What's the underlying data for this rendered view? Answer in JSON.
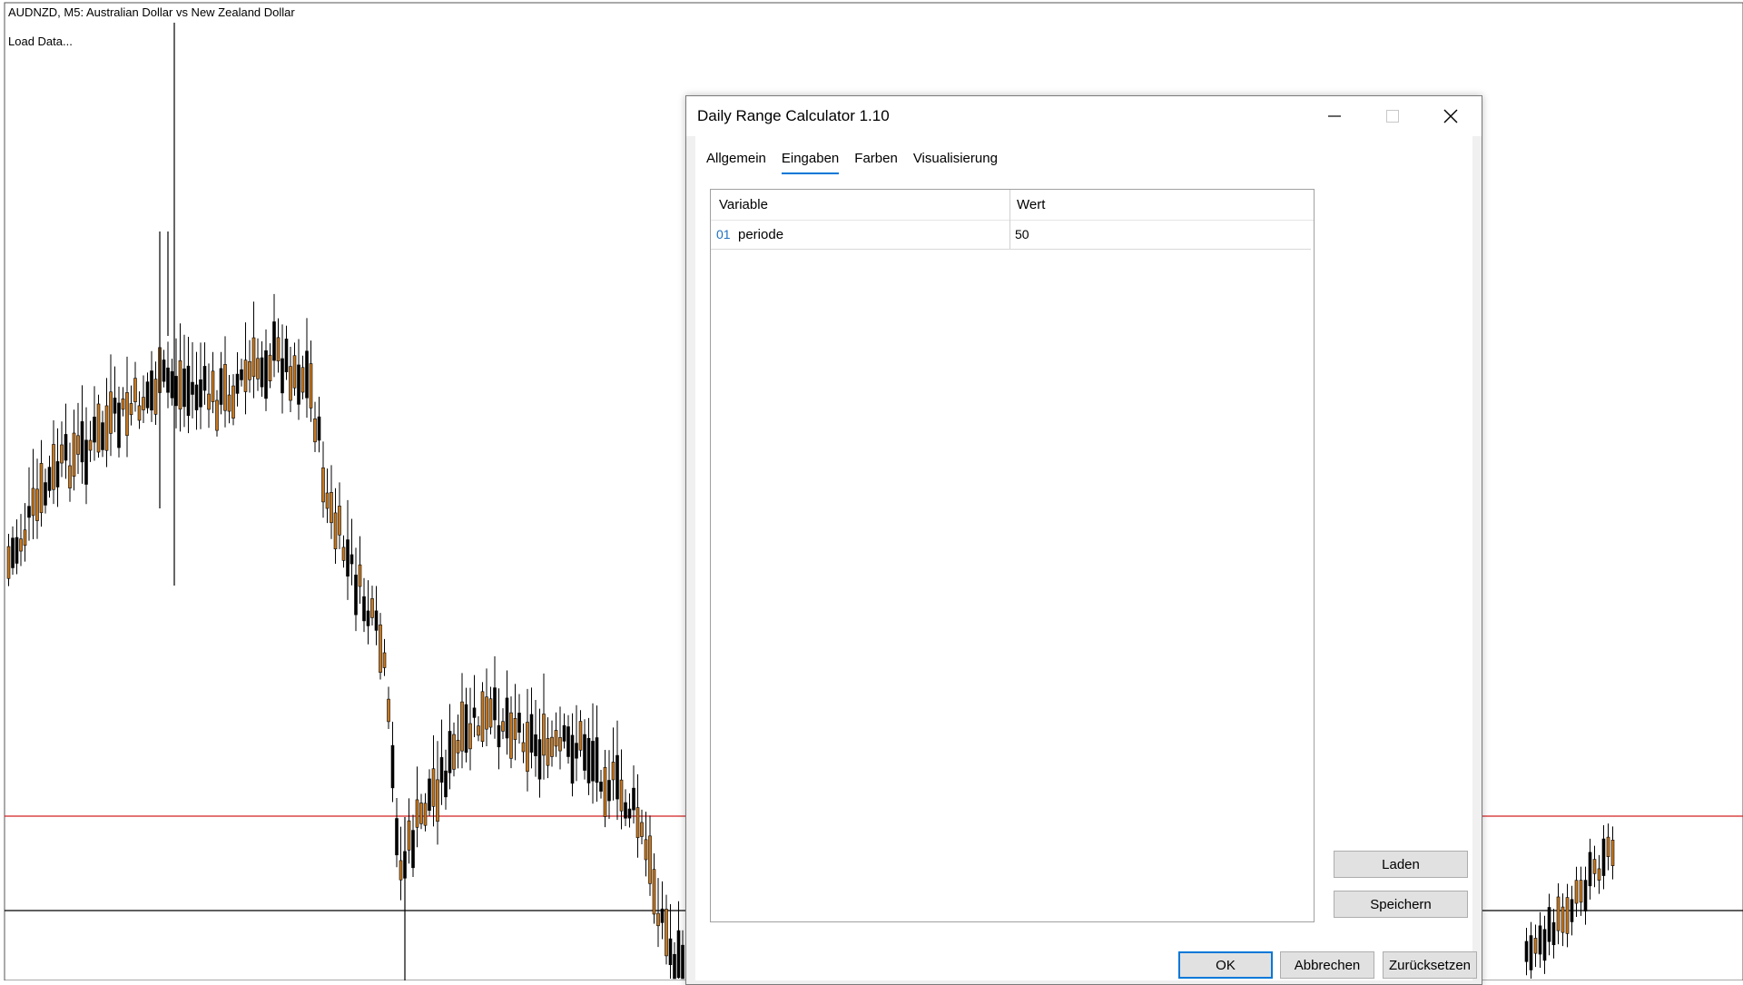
{
  "chart": {
    "title": "AUDNZD, M5:  Australian Dollar vs New Zealand Dollar",
    "status": "Load Data...",
    "colors": {
      "bull": "#000000",
      "bear": "#c8781e",
      "hline_red": "#d32020",
      "hline_black": "#000000"
    }
  },
  "dialog": {
    "title": "Daily Range Calculator 1.10",
    "tabs": [
      {
        "label": "Allgemein",
        "active": false
      },
      {
        "label": "Eingaben",
        "active": true
      },
      {
        "label": "Farben",
        "active": false
      },
      {
        "label": "Visualisierung",
        "active": false
      }
    ],
    "table": {
      "headers": {
        "variable": "Variable",
        "wert": "Wert"
      },
      "rows": [
        {
          "num": "01",
          "name": "periode",
          "value": "50"
        }
      ]
    },
    "buttons": {
      "laden": "Laden",
      "speichern": "Speichern",
      "ok": "OK",
      "abbrechen": "Abbrechen",
      "zuruecksetzen": "Zurücksetzen"
    },
    "accent": "#0078d7"
  }
}
